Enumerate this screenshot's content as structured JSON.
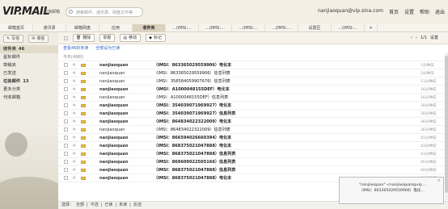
{
  "brand": {
    "logo": "VIP.MAIL",
    "sub": "新浪邮箱"
  },
  "search": {
    "placeholder": "搜索邮件、通讯录、网盘文件等"
  },
  "user": {
    "email": "nanjiaoquan@vip.sina.com"
  },
  "toplinks": [
    "首页",
    "设置",
    "帮助",
    "退出"
  ],
  "nav": {
    "tabs": [
      "邮箱首页",
      "通讯录",
      "邮箱网盘",
      "应用",
      "收件夹",
      "...(IMSI:...",
      "...(IMSI:...",
      "...(IMSI:...",
      "...(IMSI:...",
      "设置区",
      "...(IMSI:..."
    ],
    "active_index": 4,
    "close": "×"
  },
  "actions": {
    "compose": "写信",
    "receive": "收信"
  },
  "sidebar": {
    "folders": [
      {
        "label": "收件夹",
        "count": "46"
      },
      {
        "label": "星标邮件",
        "count": ""
      },
      {
        "label": "草稿夹",
        "count": ""
      },
      {
        "label": "已发送",
        "count": ""
      },
      {
        "label": "垃圾邮件",
        "count": "13"
      },
      {
        "label": "更多分类",
        "count": ""
      },
      {
        "label": "代收邮箱",
        "count": ""
      }
    ]
  },
  "toolbar": {
    "delete": "删除",
    "report": "举报",
    "move": "移动",
    "mark": "标记",
    "page": "1/1",
    "page_prev": "‹",
    "page_next": "›",
    "settings": "设置"
  },
  "filters": {
    "unread": "查看46封未读",
    "all_read": "全部设为已读"
  },
  "group": {
    "label": "今天(49封)"
  },
  "emails": [
    {
      "from": "nanjiaoquan",
      "subject": "（IMSI：863365029559906）电化本",
      "time": "1分钟前",
      "unread": true
    },
    {
      "from": "nanjiaoquan",
      "subject": "（IMSI：863365029559906）信息列表",
      "time": "2分钟前",
      "unread": false
    },
    {
      "from": "nanjiaoquan",
      "subject": "（IMSI：358584059907676）信息列表",
      "time": "11分钟前",
      "unread": false
    },
    {
      "from": "nanjiaoquan",
      "subject": "（IMSI：A1000048155DEF）电化本",
      "time": "16分钟前",
      "unread": true
    },
    {
      "from": "nanjiaoquan",
      "subject": "（IMSI：A1000048155DEF）信息列表",
      "time": "16分钟前",
      "unread": false
    },
    {
      "from": "nanjiaoquan",
      "subject": "（IMSI：354039071969927）电化本",
      "time": "30分钟前",
      "unread": true
    },
    {
      "from": "nanjiaoquan",
      "subject": "（IMSI：354039071969927）信息列表",
      "time": "30分钟前",
      "unread": true
    },
    {
      "from": "nanjiaoquan",
      "subject": "（IMSI：864834022322009）电化本",
      "time": "36分钟前",
      "unread": true
    },
    {
      "from": "nanjiaoquan",
      "subject": "（IMSI：864834022322009）信息列表",
      "time": "36分钟前",
      "unread": false
    },
    {
      "from": "nanjiaoquan",
      "subject": "（IMSI：866594026660394）电化本",
      "time": "41分钟前",
      "unread": true
    },
    {
      "from": "nanjiaoquan",
      "subject": "（IMSI：868375021047888）电化本",
      "time": "43分钟前",
      "unread": true
    },
    {
      "from": "nanjiaoquan",
      "subject": "（IMSI：868375021047888）信息列表",
      "time": "43分钟前",
      "unread": true
    },
    {
      "from": "nanjiaoquan",
      "subject": "（IMSI：869609022505166）信息列表",
      "time": "46分钟前",
      "unread": true
    },
    {
      "from": "nanjiaoquan",
      "subject": "（IMSI：868375021047888）信息列表",
      "time": "48分钟前",
      "unread": true
    },
    {
      "from": "nanjiaoquan",
      "subject": "（IMSI：868375021047888）电化本",
      "time": "50分钟前",
      "unread": true
    }
  ],
  "bottombar": [
    "选择：",
    "全部",
    "|",
    "不选",
    "|",
    "已读",
    "|",
    "未读",
    "|",
    "反选"
  ],
  "popup": {
    "line1": "\"nanjiaoquan\" <nanjiaoquan@vip....",
    "line2": "（IMSI：863365029559906）电化...",
    "close": "×"
  },
  "colors": {
    "accent": "#d9d2bf",
    "link": "#3366cc",
    "envelope": "#e8c144"
  }
}
